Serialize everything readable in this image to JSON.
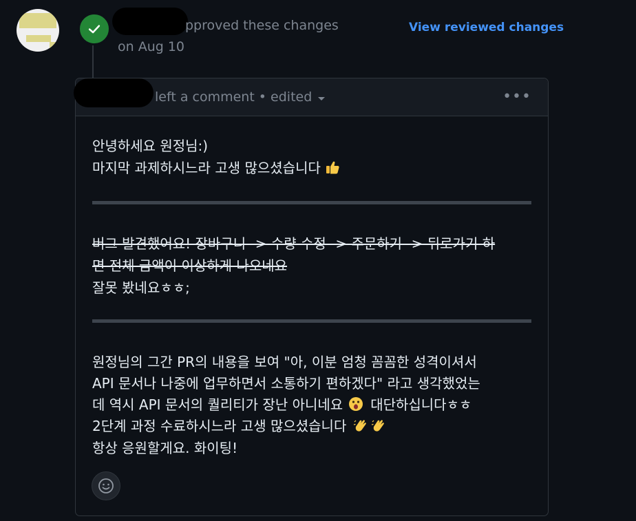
{
  "review": {
    "status_text": "pproved these changes",
    "date": "on Aug 10",
    "view_link": "View reviewed changes"
  },
  "comment": {
    "header_text": "left a comment • edited",
    "lines_section1": [
      "안녕하세요 원정님:)",
      "마지막 과제하시느라 고생 많으셨습니다"
    ],
    "strike_lines": [
      "버그 발견했어요! 장바구니 -> 수량 수정 -> 주문하기 -> 뒤로가기 하",
      "면 전체 금액이 이상하게 나오네요"
    ],
    "after_strike": "잘못 봤네요ㅎㅎ;",
    "lines_section3": [
      "원정님의 그간 PR의 내용을 보여 \"아, 이분 엄청 꼼꼼한 성격이셔서",
      "API 문서나 나중에 업무하면서 소통하기 편하겠다\" 라고 생각했었는",
      "데 역시 API 문서의 퀄리티가 장난 아니네요",
      "대단하십니다ㅎㅎ",
      "2단계 과정 수료하시느라 고생 많으셨습니다",
      "항상 응원할게요. 화이팅!"
    ]
  },
  "icons": {
    "check": "check-icon",
    "thumbs_up": "thumbs-up-icon",
    "astonished": "astonished-face-icon",
    "clap": "clapping-hands-icon",
    "smiley": "smiley-icon"
  },
  "colors": {
    "background": "#0d1117",
    "link": "#4493f8",
    "success": "#238636"
  }
}
